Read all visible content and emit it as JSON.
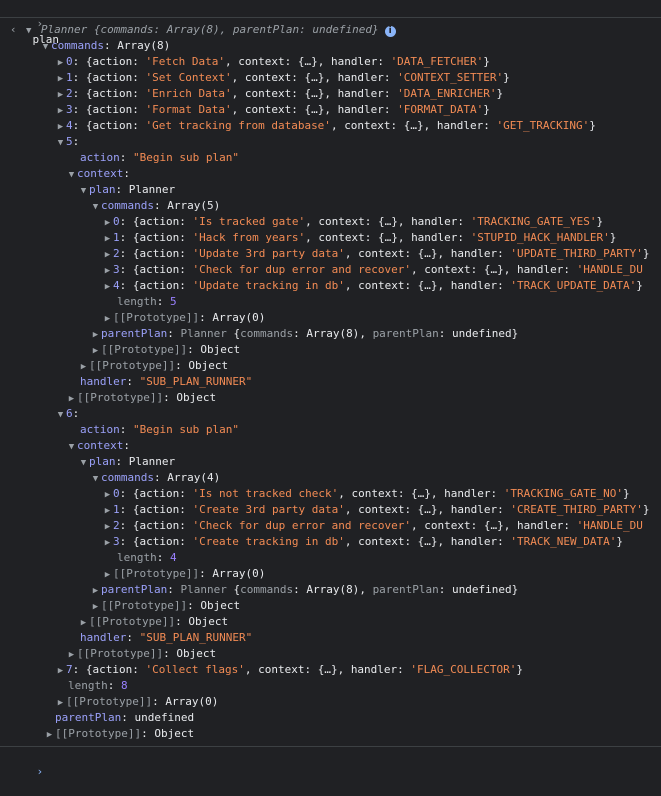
{
  "input_line": {
    "prompt": "›",
    "command": "plan"
  },
  "result_prompt": "‹",
  "planner_header": {
    "class_name": "Planner",
    "summary": "{commands: Array(8), parentPlan: undefined}",
    "info": "i"
  },
  "commands_key": "commands",
  "commands_type": "Array(8)",
  "entries": [
    {
      "idx": "0",
      "action": "'Fetch Data'",
      "handler": "'DATA_FETCHER'"
    },
    {
      "idx": "1",
      "action": "'Set Context'",
      "handler": "'CONTEXT_SETTER'"
    },
    {
      "idx": "2",
      "action": "'Enrich Data'",
      "handler": "'DATA_ENRICHER'"
    },
    {
      "idx": "3",
      "action": "'Format Data'",
      "handler": "'FORMAT_DATA'"
    },
    {
      "idx": "4",
      "action": "'Get tracking from database'",
      "handler": "'GET_TRACKING'"
    }
  ],
  "subplan5": {
    "idx": "5",
    "action": "\"Begin sub plan\"",
    "commands_type": "Array(5)",
    "commands": [
      {
        "idx": "0",
        "action": "'Is tracked gate'",
        "handler": "'TRACKING_GATE_YES'"
      },
      {
        "idx": "1",
        "action": "'Hack from years'",
        "handler": "'STUPID_HACK_HANDLER'"
      },
      {
        "idx": "2",
        "action": "'Update 3rd party data'",
        "handler": "'UPDATE_THIRD_PARTY'"
      },
      {
        "idx": "3",
        "action": "'Check for dup error and recover'",
        "handler": "'HANDLE_DU"
      },
      {
        "idx": "4",
        "action": "'Update tracking in db'",
        "handler": "'TRACK_UPDATE_DATA'"
      }
    ],
    "length": "5",
    "handler": "\"SUB_PLAN_RUNNER\""
  },
  "subplan6": {
    "idx": "6",
    "action": "\"Begin sub plan\"",
    "commands_type": "Array(4)",
    "commands": [
      {
        "idx": "0",
        "action": "'Is not tracked check'",
        "handler": "'TRACKING_GATE_NO'"
      },
      {
        "idx": "1",
        "action": "'Create 3rd party data'",
        "handler": "'CREATE_THIRD_PARTY'"
      },
      {
        "idx": "2",
        "action": "'Check for dup error and recover'",
        "handler": "'HANDLE_DU"
      },
      {
        "idx": "3",
        "action": "'Create tracking in db'",
        "handler": "'TRACK_NEW_DATA'"
      }
    ],
    "length": "4",
    "handler": "\"SUB_PLAN_RUNNER\""
  },
  "entry7": {
    "idx": "7",
    "action": "'Collect flags'",
    "handler": "'FLAG_COLLECTOR'"
  },
  "commands_length": "8",
  "parent_plan_value": "undefined",
  "labels": {
    "action": "action",
    "context": "context",
    "handler": "handler",
    "plan": "plan",
    "planner": "Planner",
    "commands": "commands",
    "length": "length",
    "parentPlan": "parentPlan",
    "prototype": "[[Prototype]]",
    "object": "Object",
    "array0": "Array(0)",
    "context_collapsed": "{…}",
    "parent_summary_key": "commands",
    "parent_summary_type": "Array(8)",
    "parent_summary_key2": "parentPlan",
    "parent_summary_val2": "undefined"
  },
  "bottom_prompt": "›"
}
